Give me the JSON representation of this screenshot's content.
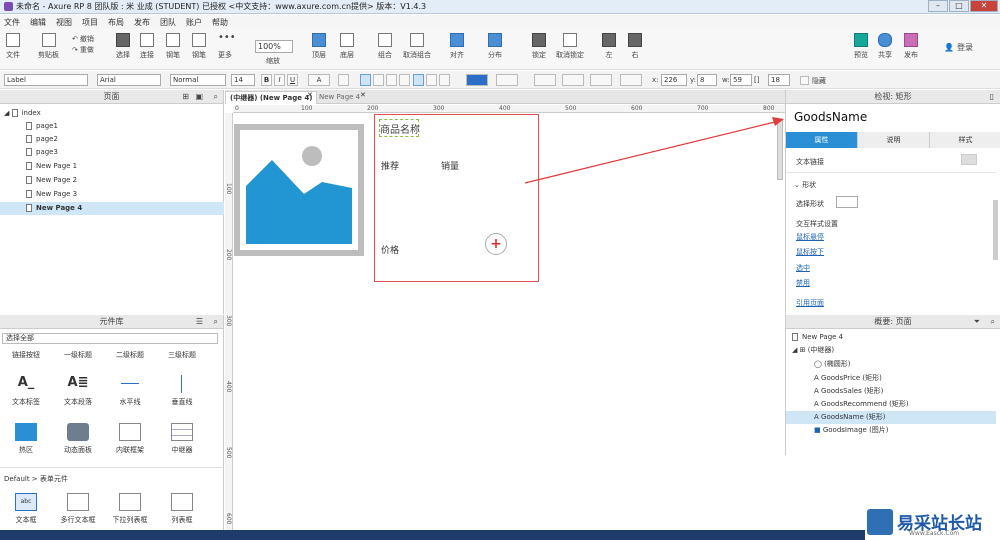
{
  "window": {
    "title": "未命名 - Axure RP 8 团队版 : 米 业成 (STUDENT) 已授权     <中文支持：www.axure.com.cn提供> 版本：V1.4.3",
    "min": "–",
    "max": "□",
    "close": "✕"
  },
  "menu": [
    "文件",
    "编辑",
    "视图",
    "项目",
    "布局",
    "发布",
    "团队",
    "账户",
    "帮助"
  ],
  "toolbar": {
    "file": "文件",
    "clipboard": "剪贴板",
    "undo": "撤销",
    "redo": "重做",
    "select": "选择",
    "connect": "连接",
    "pen": "钢笔",
    "more": "更多",
    "zoom_value": "100%",
    "zoom_label": "缩放",
    "top": "顶层",
    "bottom": "底层",
    "group": "组合",
    "ungroup": "取消组合",
    "align": "对齐",
    "distribute": "分布",
    "lock": "锁定",
    "unlock": "取消锁定",
    "left": "左",
    "right": "右",
    "preview": "预览",
    "share": "共享",
    "publish": "发布",
    "login": "登录"
  },
  "format": {
    "style": "Label",
    "font": "Arial",
    "weight": "Normal",
    "size": "14",
    "bold": "B",
    "italic": "I",
    "underline": "U",
    "fontcolor": "A",
    "x_label": "x:",
    "x": "226",
    "y_label": "y:",
    "y": "8",
    "w_label": "w:",
    "w": "59",
    "h_label": "[]",
    "h": "18",
    "hidden": "隐藏"
  },
  "pages_panel": {
    "title": "页面",
    "items": [
      {
        "label": "index"
      },
      {
        "label": "page1"
      },
      {
        "label": "page2"
      },
      {
        "label": "page3"
      },
      {
        "label": "New Page 1"
      },
      {
        "label": "New Page 2"
      },
      {
        "label": "New Page 3"
      },
      {
        "label": "New Page 4"
      }
    ]
  },
  "library": {
    "title": "元件库",
    "select": "选择全部",
    "row1": [
      "链接按钮",
      "一级标题",
      "二级标题",
      "三级标题"
    ],
    "row2": [
      "文本标签",
      "文本段落",
      "水平线",
      "垂直线"
    ],
    "row3": [
      "热区",
      "动态面板",
      "内联框架",
      "中继器"
    ],
    "section": "Default > 表单元件",
    "row4": [
      "文本框",
      "多行文本框",
      "下拉列表框",
      "列表框"
    ]
  },
  "canvas": {
    "tab_active": "(中继器) (New Page 4)",
    "tab_other": "New Page 4",
    "ruler_h": [
      "0",
      "100",
      "200",
      "300",
      "400",
      "500",
      "600",
      "700",
      "800"
    ],
    "ruler_v": [
      "100",
      "200",
      "300",
      "400",
      "500",
      "600"
    ],
    "goods_name": "商品名称",
    "recommend": "推荐",
    "sales": "销量",
    "price": "价格",
    "add": "+"
  },
  "inspector": {
    "title": "检视: 矩形",
    "name": "GoodsName",
    "tabs": [
      "属性",
      "说明",
      "样式"
    ],
    "text_link": "文本链接",
    "shape_section": "形状",
    "select_shape": "选择形状",
    "interaction": "交互样式设置",
    "links": [
      "鼠标悬停",
      "鼠标按下",
      "选中",
      "禁用"
    ],
    "ref_page": "引用页面"
  },
  "outline": {
    "title": "概要: 页面",
    "items": [
      {
        "label": "New Page 4"
      },
      {
        "label": "(中继器)"
      },
      {
        "label": "(椭圆形)"
      },
      {
        "label": "GoodsPrice (矩形)"
      },
      {
        "label": "GoodsSales (矩形)"
      },
      {
        "label": "GoodsRecommend (矩形)"
      },
      {
        "label": "GoodsName (矩形)"
      },
      {
        "label": "GoodsImage (图片)"
      }
    ]
  },
  "watermark": {
    "text": "易采站长站",
    "sub": "Www.Easck.Com"
  },
  "colors": {
    "accent": "#2b8fd6",
    "repeater_border": "#e05050",
    "arrow": "#e03a3a",
    "image_fill": "#2196d3"
  }
}
